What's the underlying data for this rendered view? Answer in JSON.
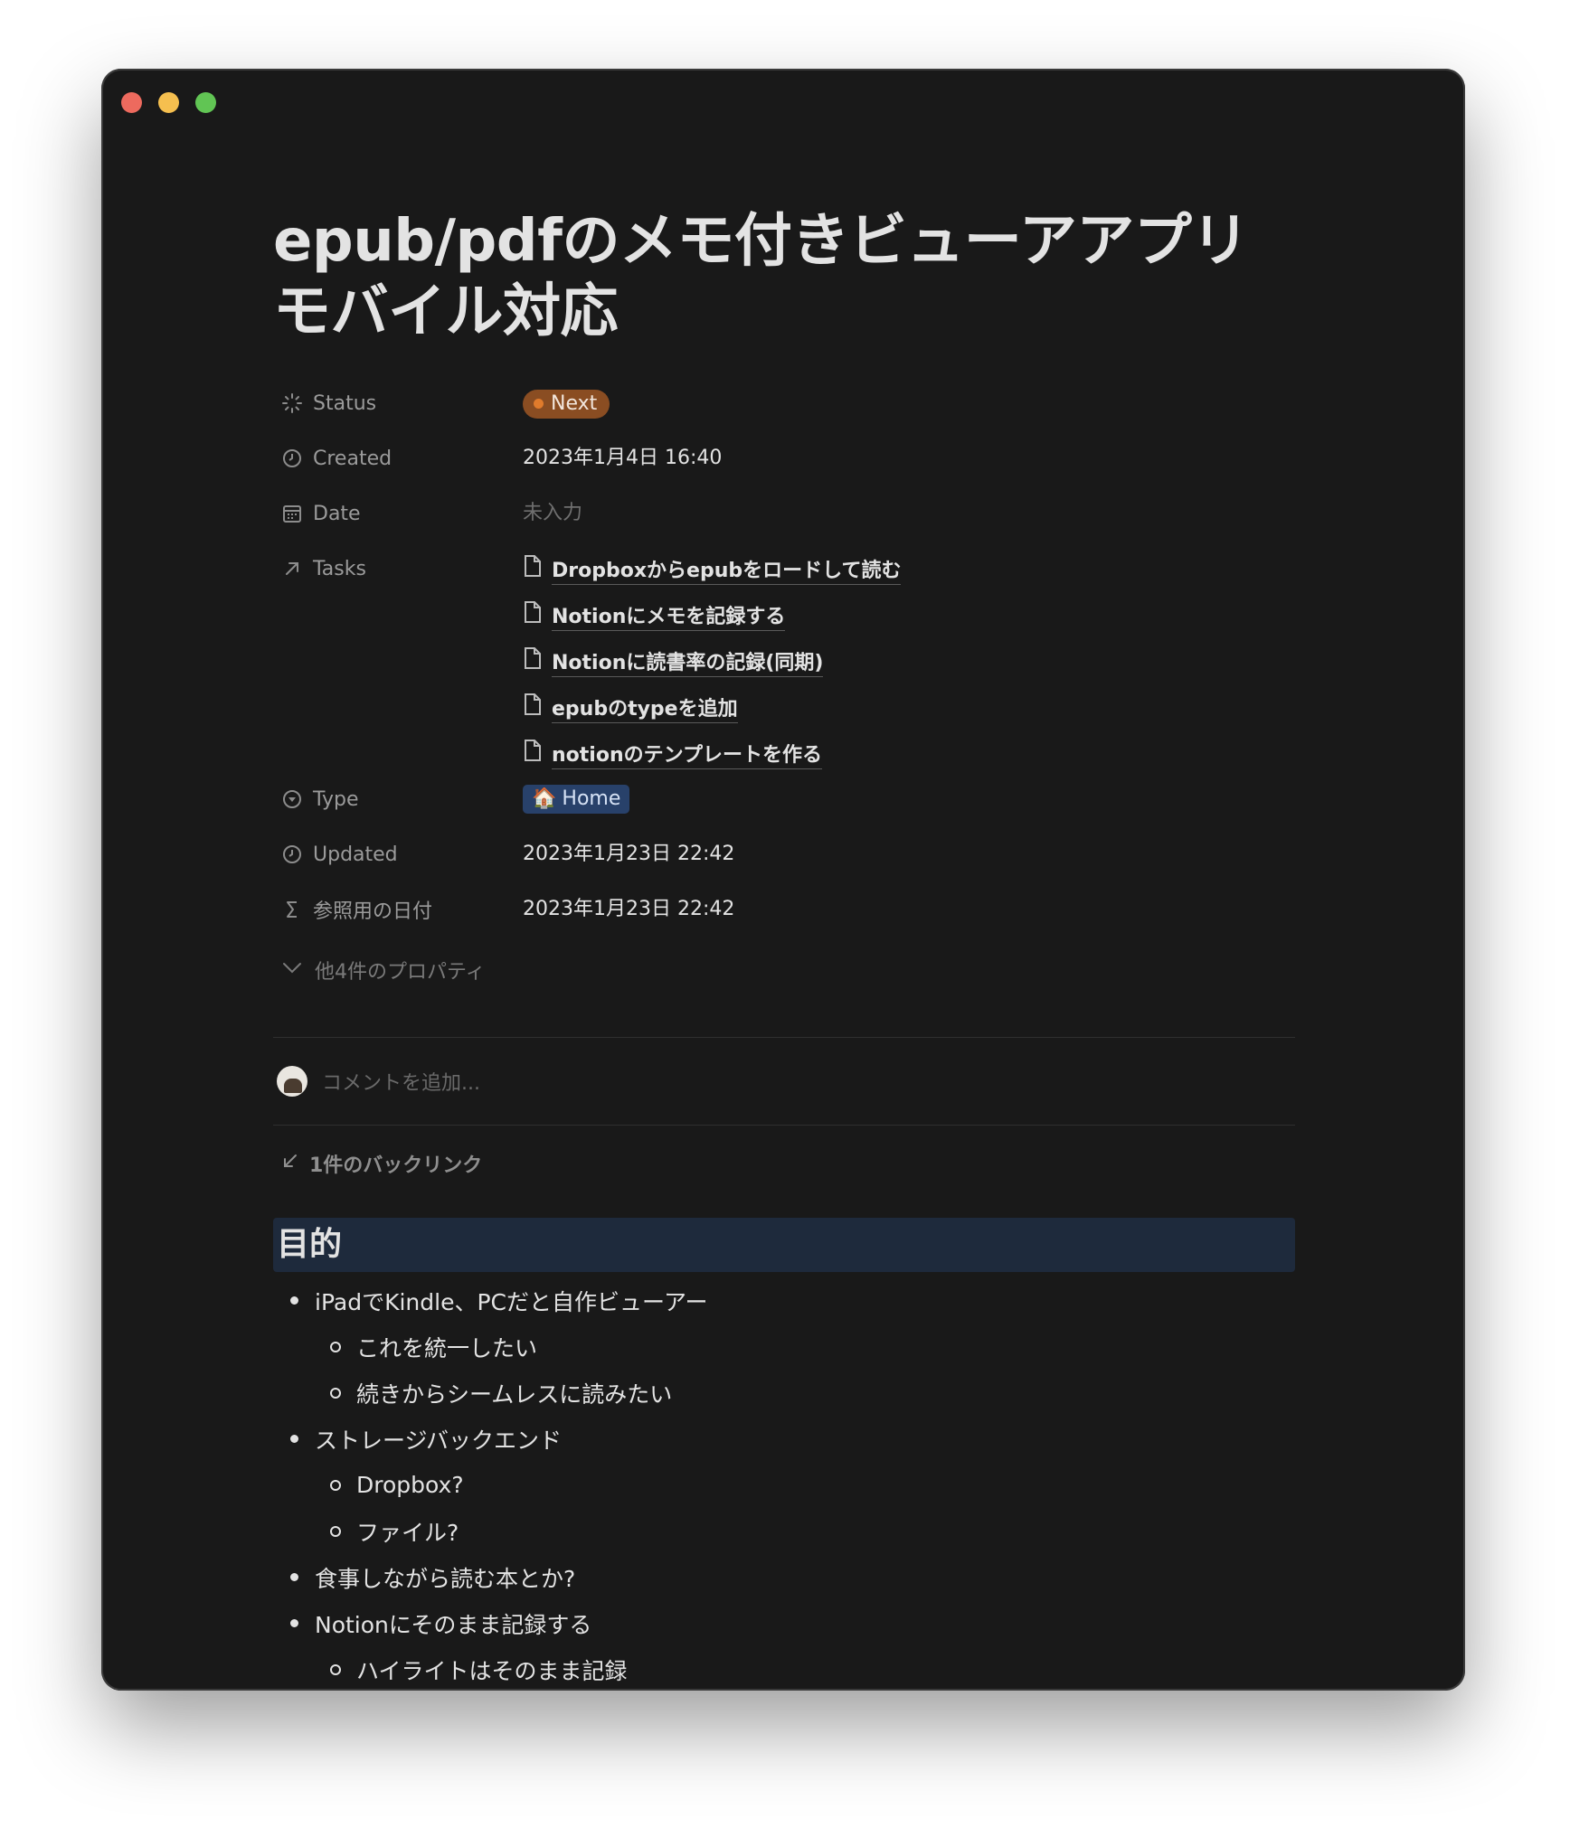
{
  "window": {
    "traffic_lights": {
      "close_color": "#ed6a5e",
      "minimize_color": "#f5bf4f",
      "maximize_color": "#61c554"
    }
  },
  "page": {
    "title": "epub/pdfのメモ付きビューアアプリ モバイル対応"
  },
  "properties": {
    "status": {
      "name": "Status",
      "value": "Next",
      "icon": "status-icon"
    },
    "created": {
      "name": "Created",
      "value": "2023年1月4日 16:40",
      "icon": "clock-icon"
    },
    "date": {
      "name": "Date",
      "value": "未入力",
      "icon": "calendar-icon"
    },
    "tasks": {
      "name": "Tasks",
      "icon": "arrow-up-right-icon",
      "items": [
        "Dropboxからepubをロードして読む",
        "Notionにメモを記録する",
        "Notionに読書率の記録(同期)",
        "epubのtypeを追加",
        "notionのテンプレートを作る"
      ]
    },
    "type": {
      "name": "Type",
      "value": "Home",
      "emoji": "🏠",
      "icon": "select-icon"
    },
    "updated": {
      "name": "Updated",
      "value": "2023年1月23日 22:42",
      "icon": "clock-icon"
    },
    "ref_date": {
      "name": "参照用の日付",
      "value": "2023年1月23日 22:42",
      "icon": "sigma-icon"
    },
    "more": "他4件のプロパティ"
  },
  "comment": {
    "placeholder": "コメントを追加..."
  },
  "backlinks": {
    "label": "1件のバックリンク"
  },
  "body": {
    "heading": "目的",
    "bullets": [
      {
        "level": 1,
        "text": "iPadでKindle、PCだと自作ビューアー"
      },
      {
        "level": 2,
        "text": "これを統一したい"
      },
      {
        "level": 2,
        "text": "続きからシームレスに読みたい"
      },
      {
        "level": 1,
        "text": "ストレージバックエンド"
      },
      {
        "level": 2,
        "text": "Dropbox?"
      },
      {
        "level": 2,
        "text": "ファイル?"
      },
      {
        "level": 1,
        "text": "食事しながら読む本とか?"
      },
      {
        "level": 1,
        "text": "Notionにそのまま記録する"
      },
      {
        "level": 2,
        "text": "ハイライトはそのまま記録"
      }
    ]
  }
}
